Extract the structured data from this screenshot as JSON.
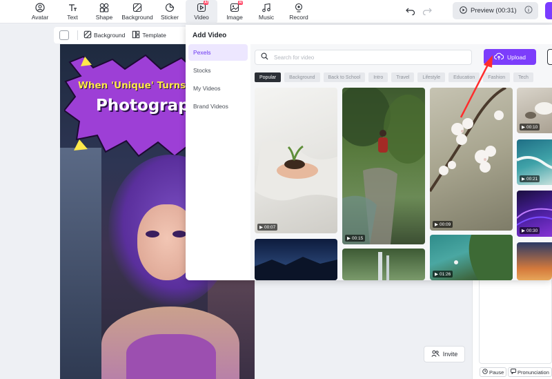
{
  "toolbar": {
    "tools": [
      {
        "label": "Avatar",
        "icon": "avatar-icon"
      },
      {
        "label": "Text",
        "icon": "text-icon"
      },
      {
        "label": "Shape",
        "icon": "shape-icon"
      },
      {
        "label": "Background",
        "icon": "background-icon"
      },
      {
        "label": "Sticker",
        "icon": "sticker-icon"
      },
      {
        "label": "Video",
        "icon": "video-icon",
        "badge": "AI",
        "active": true
      },
      {
        "label": "Image",
        "icon": "image-icon",
        "badge": "AI"
      },
      {
        "label": "Music",
        "icon": "music-icon"
      },
      {
        "label": "Record",
        "icon": "record-icon"
      }
    ],
    "preview_label": "Preview (00:31)",
    "accent": "#7a3cff"
  },
  "subbar": {
    "background_label": "Background",
    "template_label": "Template"
  },
  "canvas": {
    "banner_line1": "When 'Unique' Turns Into",
    "banner_line2": "Photography"
  },
  "panel": {
    "title": "Add Video",
    "nav": [
      {
        "label": "Pexels",
        "active": true
      },
      {
        "label": "Stocks"
      },
      {
        "label": "My Videos"
      },
      {
        "label": "Brand Videos"
      }
    ],
    "search_placeholder": "Search for video",
    "upload_label": "Upload",
    "tags": [
      "Popular",
      "Background",
      "Back to School",
      "Intro",
      "Travel",
      "Lifestyle",
      "Education",
      "Fashion",
      "Tech"
    ],
    "videos": [
      {
        "duration": "00:07",
        "desc": "hands-with-soil"
      },
      {
        "duration": "00:15",
        "desc": "woman-in-forest"
      },
      {
        "duration": "00:09",
        "desc": "white-blossoms"
      },
      {
        "duration": "00:10",
        "desc": "rocky-shore"
      },
      {
        "duration": "00:21",
        "desc": "ocean-waves"
      },
      {
        "duration": "00:30",
        "desc": "purple-abstract"
      },
      {
        "duration": "",
        "desc": "mountain-lake-night"
      },
      {
        "duration": "",
        "desc": "waterfall"
      },
      {
        "duration": "01:26",
        "desc": "aerial-coast"
      },
      {
        "duration": "",
        "desc": "sunset-sky"
      }
    ]
  },
  "right": {
    "invite_label": "Invite",
    "pause_label": "Pause",
    "pronunciation_label": "Pronunciation"
  }
}
